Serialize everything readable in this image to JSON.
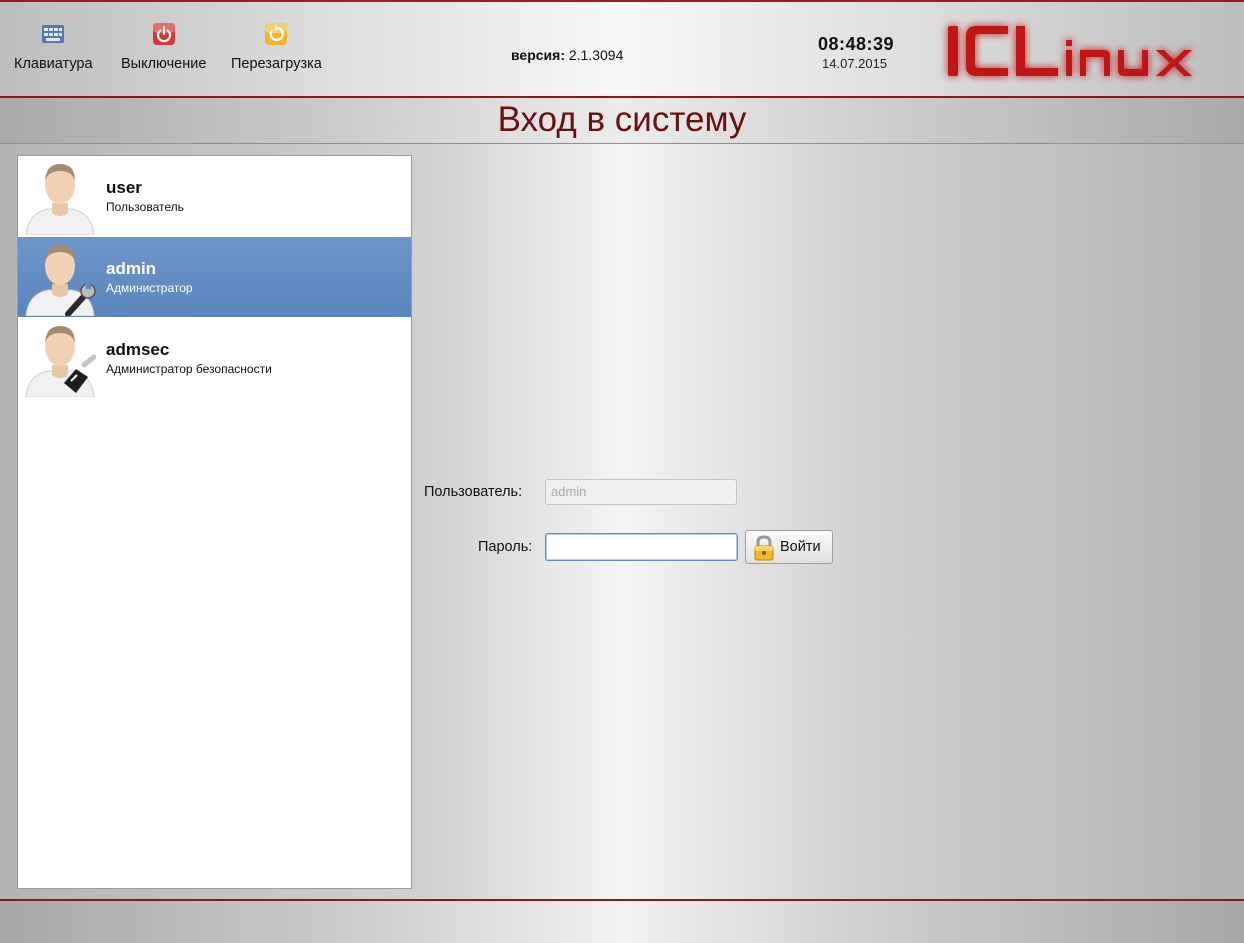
{
  "toolbar": {
    "keyboard_label": "Клавиатура",
    "shutdown_label": "Выключение",
    "reboot_label": "Перезагрузка"
  },
  "version": {
    "label": "версия:",
    "value": "2.1.3094"
  },
  "clock": {
    "time": "08:48:39",
    "date": "14.07.2015"
  },
  "logo": {
    "text": "ICLinux"
  },
  "title": "Вход в систему",
  "users": [
    {
      "name": "user",
      "role": "Пользователь",
      "selected": false
    },
    {
      "name": "admin",
      "role": "Администратор",
      "selected": true
    },
    {
      "name": "admsec",
      "role": "Администратор безопасности",
      "selected": false
    }
  ],
  "form": {
    "user_label": "Пользователь:",
    "user_value": "admin",
    "password_label": "Пароль:",
    "password_value": "",
    "login_button": "Войти"
  },
  "colors": {
    "accent_red": "#8c1818",
    "title_red": "#6b1010",
    "selection_blue": "#6288c1"
  }
}
